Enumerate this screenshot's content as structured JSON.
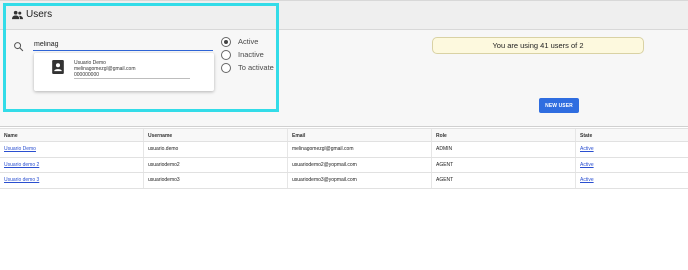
{
  "header": {
    "title": "Users",
    "icon": "users-icon"
  },
  "search": {
    "value": "melinag",
    "icon": "search-icon"
  },
  "dropdown": {
    "avatar_icon": "contact-card-icon",
    "name": "Usuario Demo",
    "email": "melinagomezgl@gmail.com",
    "phone": "000000000"
  },
  "filters": [
    {
      "label": "Active",
      "checked": true
    },
    {
      "label": "Inactive",
      "checked": false
    },
    {
      "label": "To activate",
      "checked": false
    }
  ],
  "usage": {
    "text": "You are using 41 users of 2"
  },
  "actions": {
    "new_user_label": "NEW USER"
  },
  "table": {
    "headers": [
      "Name",
      "Username",
      "Email",
      "Role",
      "State"
    ],
    "rows": [
      {
        "name": "Usuario Demo",
        "username": "usuario.demo",
        "email": "melinagomezgl@gmail.com",
        "role": "ADMIN",
        "state": "Active"
      },
      {
        "name": "Usuario demo 2",
        "username": "usuariodemo2",
        "email": "usuariodemo2@yopmail.com",
        "role": "AGENT",
        "state": "Active"
      },
      {
        "name": "Usuario demo 3",
        "username": "usuariodemo3",
        "email": "usuariodemo3@yopmail.com",
        "role": "AGENT",
        "state": "Active"
      }
    ]
  },
  "colors": {
    "accent": "#2f6de0",
    "highlight": "#33dce8",
    "badge_bg": "#fdf9de",
    "link": "#2a4fd0"
  }
}
